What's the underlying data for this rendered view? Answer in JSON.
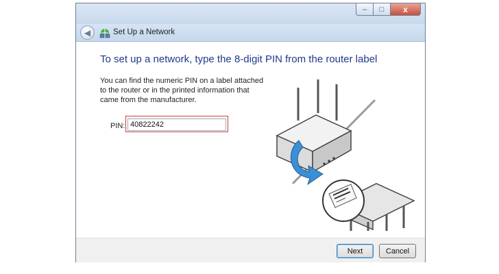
{
  "window": {
    "title": "Set Up a Network",
    "caption_buttons": {
      "minimize": "–",
      "maximize": "□",
      "close": "x"
    }
  },
  "nav": {
    "back_icon": "back-arrow-icon",
    "network_icon": "network-setup-icon"
  },
  "main": {
    "heading": "To set up a network, type the 8-digit PIN from the router label",
    "description": "You can find the numeric PIN on a label attached to the router or in the printed information that came from the manufacturer.",
    "pin_label": "PIN:",
    "pin_value": "40822242"
  },
  "footer": {
    "next_label": "Next",
    "cancel_label": "Cancel"
  },
  "colors": {
    "heading": "#1e3a8a",
    "pin_highlight": "#d33a3a",
    "arrow": "#3b8fd6"
  }
}
